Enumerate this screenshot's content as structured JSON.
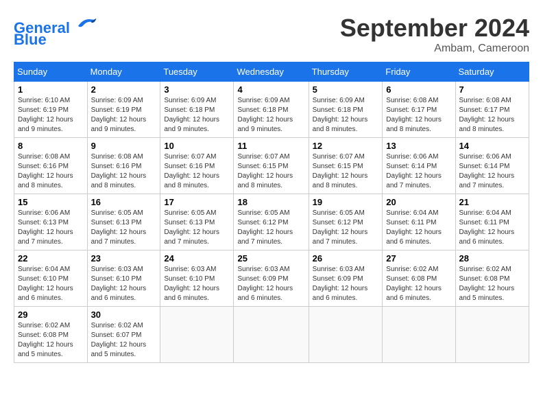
{
  "logo": {
    "line1": "General",
    "line2": "Blue"
  },
  "title": "September 2024",
  "location": "Ambam, Cameroon",
  "weekdays": [
    "Sunday",
    "Monday",
    "Tuesday",
    "Wednesday",
    "Thursday",
    "Friday",
    "Saturday"
  ],
  "weeks": [
    [
      {
        "day": 1,
        "sunrise": "6:10 AM",
        "sunset": "6:19 PM",
        "daylight": "12 hours and 9 minutes."
      },
      {
        "day": 2,
        "sunrise": "6:09 AM",
        "sunset": "6:19 PM",
        "daylight": "12 hours and 9 minutes."
      },
      {
        "day": 3,
        "sunrise": "6:09 AM",
        "sunset": "6:18 PM",
        "daylight": "12 hours and 9 minutes."
      },
      {
        "day": 4,
        "sunrise": "6:09 AM",
        "sunset": "6:18 PM",
        "daylight": "12 hours and 9 minutes."
      },
      {
        "day": 5,
        "sunrise": "6:09 AM",
        "sunset": "6:18 PM",
        "daylight": "12 hours and 8 minutes."
      },
      {
        "day": 6,
        "sunrise": "6:08 AM",
        "sunset": "6:17 PM",
        "daylight": "12 hours and 8 minutes."
      },
      {
        "day": 7,
        "sunrise": "6:08 AM",
        "sunset": "6:17 PM",
        "daylight": "12 hours and 8 minutes."
      }
    ],
    [
      {
        "day": 8,
        "sunrise": "6:08 AM",
        "sunset": "6:16 PM",
        "daylight": "12 hours and 8 minutes."
      },
      {
        "day": 9,
        "sunrise": "6:08 AM",
        "sunset": "6:16 PM",
        "daylight": "12 hours and 8 minutes."
      },
      {
        "day": 10,
        "sunrise": "6:07 AM",
        "sunset": "6:16 PM",
        "daylight": "12 hours and 8 minutes."
      },
      {
        "day": 11,
        "sunrise": "6:07 AM",
        "sunset": "6:15 PM",
        "daylight": "12 hours and 8 minutes."
      },
      {
        "day": 12,
        "sunrise": "6:07 AM",
        "sunset": "6:15 PM",
        "daylight": "12 hours and 8 minutes."
      },
      {
        "day": 13,
        "sunrise": "6:06 AM",
        "sunset": "6:14 PM",
        "daylight": "12 hours and 7 minutes."
      },
      {
        "day": 14,
        "sunrise": "6:06 AM",
        "sunset": "6:14 PM",
        "daylight": "12 hours and 7 minutes."
      }
    ],
    [
      {
        "day": 15,
        "sunrise": "6:06 AM",
        "sunset": "6:13 PM",
        "daylight": "12 hours and 7 minutes."
      },
      {
        "day": 16,
        "sunrise": "6:05 AM",
        "sunset": "6:13 PM",
        "daylight": "12 hours and 7 minutes."
      },
      {
        "day": 17,
        "sunrise": "6:05 AM",
        "sunset": "6:13 PM",
        "daylight": "12 hours and 7 minutes."
      },
      {
        "day": 18,
        "sunrise": "6:05 AM",
        "sunset": "6:12 PM",
        "daylight": "12 hours and 7 minutes."
      },
      {
        "day": 19,
        "sunrise": "6:05 AM",
        "sunset": "6:12 PM",
        "daylight": "12 hours and 7 minutes."
      },
      {
        "day": 20,
        "sunrise": "6:04 AM",
        "sunset": "6:11 PM",
        "daylight": "12 hours and 6 minutes."
      },
      {
        "day": 21,
        "sunrise": "6:04 AM",
        "sunset": "6:11 PM",
        "daylight": "12 hours and 6 minutes."
      }
    ],
    [
      {
        "day": 22,
        "sunrise": "6:04 AM",
        "sunset": "6:10 PM",
        "daylight": "12 hours and 6 minutes."
      },
      {
        "day": 23,
        "sunrise": "6:03 AM",
        "sunset": "6:10 PM",
        "daylight": "12 hours and 6 minutes."
      },
      {
        "day": 24,
        "sunrise": "6:03 AM",
        "sunset": "6:10 PM",
        "daylight": "12 hours and 6 minutes."
      },
      {
        "day": 25,
        "sunrise": "6:03 AM",
        "sunset": "6:09 PM",
        "daylight": "12 hours and 6 minutes."
      },
      {
        "day": 26,
        "sunrise": "6:03 AM",
        "sunset": "6:09 PM",
        "daylight": "12 hours and 6 minutes."
      },
      {
        "day": 27,
        "sunrise": "6:02 AM",
        "sunset": "6:08 PM",
        "daylight": "12 hours and 6 minutes."
      },
      {
        "day": 28,
        "sunrise": "6:02 AM",
        "sunset": "6:08 PM",
        "daylight": "12 hours and 5 minutes."
      }
    ],
    [
      {
        "day": 29,
        "sunrise": "6:02 AM",
        "sunset": "6:08 PM",
        "daylight": "12 hours and 5 minutes."
      },
      {
        "day": 30,
        "sunrise": "6:02 AM",
        "sunset": "6:07 PM",
        "daylight": "12 hours and 5 minutes."
      },
      null,
      null,
      null,
      null,
      null
    ]
  ]
}
